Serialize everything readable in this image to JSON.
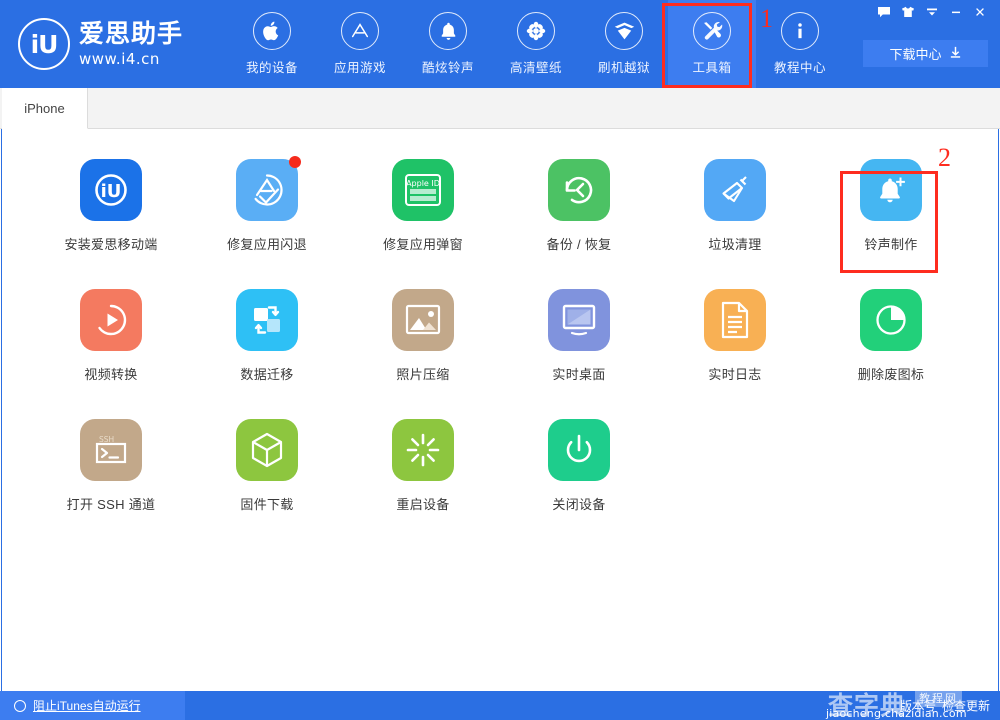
{
  "app": {
    "logo_initials": "iU",
    "logo_name": "爱思助手",
    "logo_url": "www.i4.cn"
  },
  "header": {
    "nav": [
      {
        "label": "我的设备",
        "icon": "apple-icon",
        "active": false
      },
      {
        "label": "应用游戏",
        "icon": "appstore-icon",
        "active": false
      },
      {
        "label": "酷炫铃声",
        "icon": "bell-icon",
        "active": false
      },
      {
        "label": "高清壁纸",
        "icon": "flower-icon",
        "active": false
      },
      {
        "label": "刷机越狱",
        "icon": "box-open-icon",
        "active": false
      },
      {
        "label": "工具箱",
        "icon": "tools-icon",
        "active": true
      },
      {
        "label": "教程中心",
        "icon": "info-icon",
        "active": false
      }
    ],
    "window_controls": [
      {
        "name": "feedback-icon",
        "title": "反馈"
      },
      {
        "name": "skin-icon",
        "title": "换肤"
      },
      {
        "name": "menu-icon",
        "title": "菜单"
      },
      {
        "name": "minimize-icon",
        "title": "最小化"
      },
      {
        "name": "close-icon",
        "title": "关闭"
      }
    ],
    "download_button": "下载中心"
  },
  "tabs": [
    {
      "label": "iPhone",
      "active": true
    }
  ],
  "annotations": [
    {
      "number": "1",
      "target": "工具箱"
    },
    {
      "number": "2",
      "target": "铃声制作"
    }
  ],
  "tools": [
    {
      "label": "安装爱思移动端",
      "icon": "i4-app-icon",
      "color": "#1b72e8",
      "badge": false,
      "highlight": false
    },
    {
      "label": "修复应用闪退",
      "icon": "appstore-fix-icon",
      "color": "#5aaef5",
      "badge": true,
      "highlight": false
    },
    {
      "label": "修复应用弹窗",
      "icon": "appleid-icon",
      "color": "#1fc267",
      "badge": false,
      "highlight": false
    },
    {
      "label": "备份 / 恢复",
      "icon": "restore-icon",
      "color": "#4cc264",
      "badge": false,
      "highlight": false
    },
    {
      "label": "垃圾清理",
      "icon": "broom-icon",
      "color": "#53a8f5",
      "badge": false,
      "highlight": false
    },
    {
      "label": "铃声制作",
      "icon": "bell-plus-icon",
      "color": "#45b6f2",
      "badge": false,
      "highlight": true
    },
    {
      "label": "视频转换",
      "icon": "play-circle-icon",
      "color": "#f47a60",
      "badge": false,
      "highlight": false
    },
    {
      "label": "数据迁移",
      "icon": "migrate-icon",
      "color": "#2ec0f5",
      "badge": false,
      "highlight": false
    },
    {
      "label": "照片压缩",
      "icon": "photo-icon",
      "color": "#c2a88a",
      "badge": false,
      "highlight": false
    },
    {
      "label": "实时桌面",
      "icon": "monitor-icon",
      "color": "#8093dd",
      "badge": false,
      "highlight": false
    },
    {
      "label": "实时日志",
      "icon": "document-icon",
      "color": "#f8b054",
      "badge": false,
      "highlight": false
    },
    {
      "label": "删除废图标",
      "icon": "pie-icon",
      "color": "#22d07a",
      "badge": false,
      "highlight": false
    },
    {
      "label": "打开 SSH 通道",
      "icon": "ssh-terminal-icon",
      "color": "#c2a88a",
      "badge": false,
      "highlight": false
    },
    {
      "label": "固件下载",
      "icon": "cube-icon",
      "color": "#8dc63f",
      "badge": false,
      "highlight": false
    },
    {
      "label": "重启设备",
      "icon": "restart-icon",
      "color": "#8dc63f",
      "badge": false,
      "highlight": false
    },
    {
      "label": "关闭设备",
      "icon": "power-icon",
      "color": "#1ecd8c",
      "badge": false,
      "highlight": false
    }
  ],
  "footer": {
    "block_itunes_label": "阻止iTunes自动运行",
    "version_label": "版本号",
    "check_update_label": "检查更新"
  },
  "watermark": {
    "brand": "查字典",
    "tag": "教程网",
    "url": "jiaocheng.chazidian.com"
  },
  "colors": {
    "header_blue": "#2b6fe3",
    "active_blue": "#3d7df0",
    "annotation_red": "#fe2c1f",
    "content_bg": "#ffffff"
  }
}
